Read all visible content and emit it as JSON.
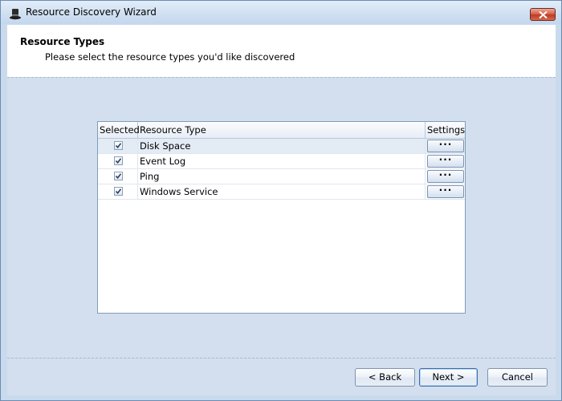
{
  "window": {
    "title": "Resource Discovery Wizard",
    "icon": "tophat-icon"
  },
  "header": {
    "title": "Resource Types",
    "subtitle": "Please select the resource types you'd like discovered"
  },
  "grid": {
    "columns": [
      "Selected",
      "Resource Type",
      "Settings"
    ],
    "rows": [
      {
        "selected": true,
        "type": "Disk Space",
        "settings": "···"
      },
      {
        "selected": true,
        "type": "Event Log",
        "settings": "···"
      },
      {
        "selected": true,
        "type": "Ping",
        "settings": "···"
      },
      {
        "selected": true,
        "type": "Windows Service",
        "settings": "···"
      }
    ]
  },
  "buttons": {
    "back": "< Back",
    "next": "Next >",
    "cancel": "Cancel"
  }
}
